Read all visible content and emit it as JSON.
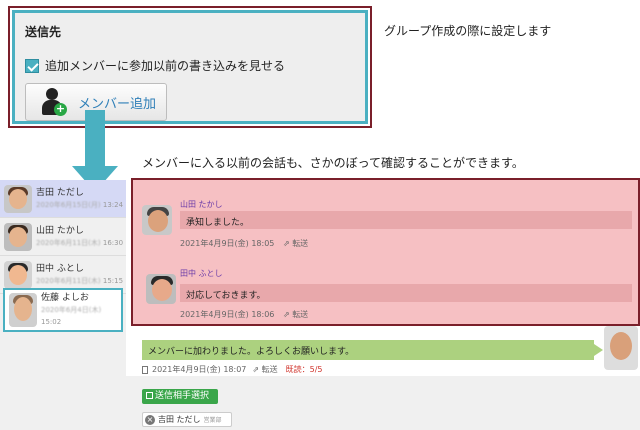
{
  "dialog": {
    "title": "送信先",
    "checkbox_label": "追加メンバーに参加以前の書き込みを見せる",
    "add_member_label": "メンバー追加"
  },
  "captions": {
    "top": "グループ作成の際に設定します",
    "middle": "メンバーに入る以前の会話も、さかのぼって確認することができます。"
  },
  "contacts": [
    {
      "name": "吉田 ただし",
      "date": "2020年6月15日(月)",
      "time": "13:24"
    },
    {
      "name": "山田 たかし",
      "date": "2020年6月11日(木)",
      "time": "16:30"
    },
    {
      "name": "田中 ふとし",
      "date": "2020年6月11日(木)",
      "time": "15:15"
    },
    {
      "name": "佐藤 よしお",
      "date": "2020年6月4日(木)",
      "time": "15:02"
    }
  ],
  "messages": [
    {
      "sender": "山田 たかし",
      "text": "承知しました。",
      "timestamp": "2021年4月9日(金) 18:05",
      "forward": "転送"
    },
    {
      "sender": "田中 ふとし",
      "text": "対応しておきます。",
      "timestamp": "2021年4月9日(金) 18:06",
      "forward": "転送"
    }
  ],
  "own_message": {
    "text": "メンバーに加わりました。よろしくお願いします。",
    "timestamp": "2021年4月9日(金) 18:07",
    "forward": "転送",
    "read": "既読：5/5"
  },
  "compose": {
    "select_button": "送信相手選択",
    "recipient_name": "吉田 ただし",
    "recipient_sub": "営業部"
  },
  "colors": {
    "accent": "#4ab0c1",
    "highlight_border": "#7a1f2a",
    "pink_area": "#f6c0c3",
    "own_bubble": "#acd17f",
    "read_count": "#d0342c"
  }
}
